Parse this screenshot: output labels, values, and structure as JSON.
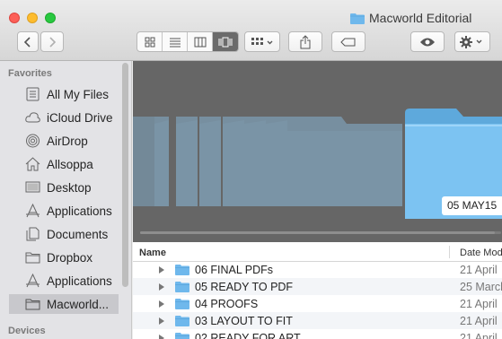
{
  "window": {
    "title": "Macworld Editorial"
  },
  "toolbar": {
    "back_icon": "chevron-left-icon",
    "forward_icon": "chevron-right-icon",
    "view_modes": [
      "icon-view-icon",
      "list-view-icon",
      "column-view-icon",
      "cover-flow-icon"
    ],
    "active_view": "cover-flow-icon",
    "arrange_icon": "arrange-grid-icon",
    "share_icon": "share-icon",
    "tag_icon": "tag-icon",
    "quicklook_icon": "eye-icon",
    "action_icon": "gear-icon"
  },
  "sidebar": {
    "favorites_heading": "Favorites",
    "items": [
      {
        "label": "All My Files",
        "icon": "all-files-icon"
      },
      {
        "label": "iCloud Drive",
        "icon": "cloud-icon"
      },
      {
        "label": "AirDrop",
        "icon": "airdrop-icon"
      },
      {
        "label": "Allsoppa",
        "icon": "home-icon"
      },
      {
        "label": "Desktop",
        "icon": "desktop-icon"
      },
      {
        "label": "Applications",
        "icon": "applications-icon"
      },
      {
        "label": "Documents",
        "icon": "documents-icon"
      },
      {
        "label": "Dropbox",
        "icon": "folder-icon"
      },
      {
        "label": "Applications",
        "icon": "applications-icon"
      },
      {
        "label": "Macworld...",
        "icon": "folder-icon",
        "selected": true
      }
    ],
    "devices_heading": "Devices"
  },
  "coverflow": {
    "selected_caption": "05 MAY15"
  },
  "list": {
    "col_name": "Name",
    "col_date": "Date Mod",
    "rows": [
      {
        "name": "06 FINAL PDFs",
        "date": "21 April"
      },
      {
        "name": "05 READY TO PDF",
        "date": "25 March"
      },
      {
        "name": "04 PROOFS",
        "date": "21 April"
      },
      {
        "name": "03 LAYOUT TO FIT",
        "date": "21 April"
      },
      {
        "name": "02 READY FOR ART",
        "date": "21 April"
      }
    ]
  },
  "colors": {
    "folder": "#6fb8ec",
    "cover_bg": "#666666",
    "sidebar_bg": "#e3e3e6",
    "selection": "#c8c8cc"
  }
}
